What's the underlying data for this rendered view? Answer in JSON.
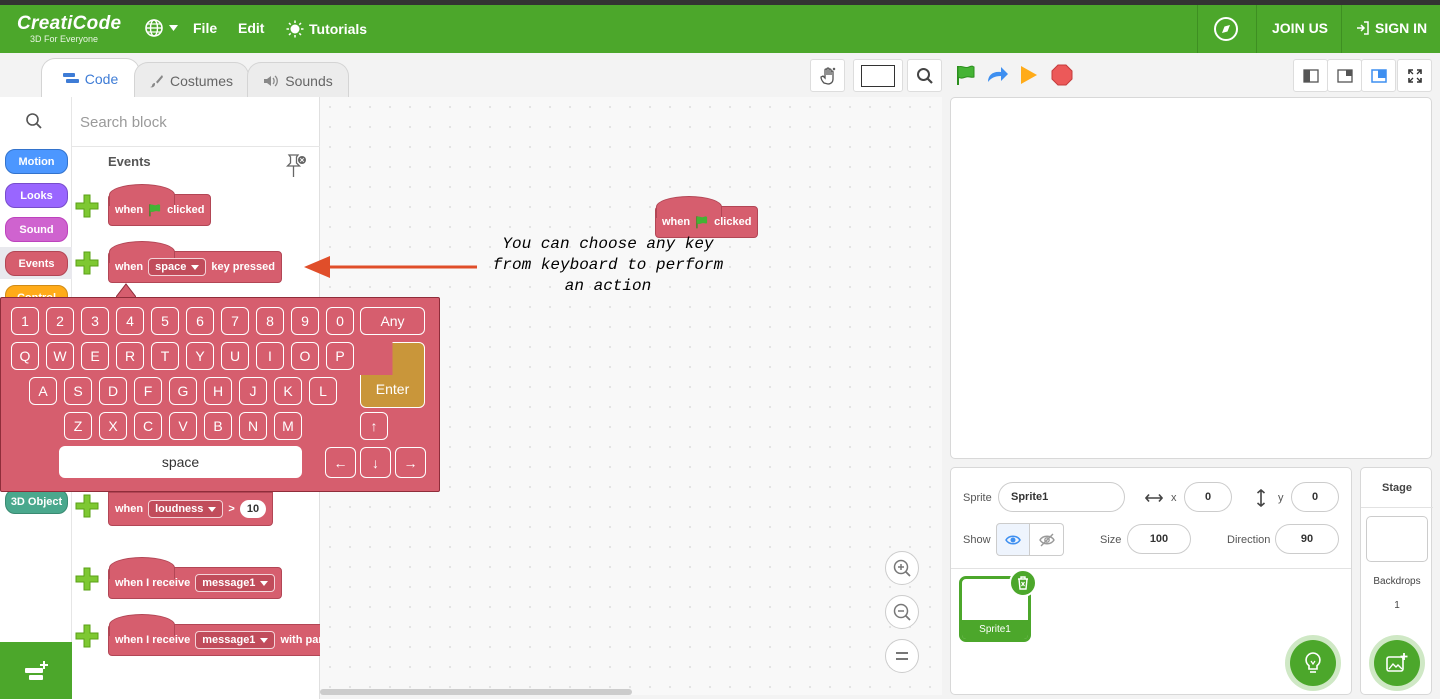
{
  "app": {
    "logo_title": "CreatiCode",
    "logo_subtitle": "3D For Everyone"
  },
  "menubar": {
    "file": "File",
    "edit": "Edit",
    "tutorials": "Tutorials",
    "join": "JOIN US",
    "signin": "SIGN IN"
  },
  "tabs": [
    {
      "label": "Code",
      "active": true
    },
    {
      "label": "Costumes"
    },
    {
      "label": "Sounds"
    }
  ],
  "search": {
    "placeholder": "Search block"
  },
  "categories": [
    {
      "label": "Motion",
      "color": "#4c97ff"
    },
    {
      "label": "Looks",
      "color": "#9966ff"
    },
    {
      "label": "Sound",
      "color": "#cf63cf"
    },
    {
      "label": "Events",
      "color": "#d65e6e"
    },
    {
      "label": "Control",
      "color": "#ffab19"
    },
    {
      "label": "3D Object",
      "color": "#4aa88d"
    }
  ],
  "palette": {
    "section_title": "Events",
    "blocks": {
      "flag_when": "when",
      "flag_clicked": "clicked",
      "key_when": "when",
      "key_value": "space",
      "key_pressed": "key pressed",
      "loud_when": "when",
      "loud_value": "loudness",
      "loud_op": ">",
      "loud_num": "10",
      "recv1_label": "when I receive",
      "recv1_value": "message1",
      "recv2_label": "when I receive",
      "recv2_value": "message1",
      "recv2_suffix": "with para"
    }
  },
  "workspace": {
    "block_when": "when",
    "block_clicked": "clicked",
    "annotation": "You can choose any key from keyboard to perform an action"
  },
  "keyboard": {
    "row1": [
      "1",
      "2",
      "3",
      "4",
      "5",
      "6",
      "7",
      "8",
      "9",
      "0"
    ],
    "any": "Any",
    "row2": [
      "Q",
      "W",
      "E",
      "R",
      "T",
      "Y",
      "U",
      "I",
      "O",
      "P"
    ],
    "row3": [
      "A",
      "S",
      "D",
      "F",
      "G",
      "H",
      "J",
      "K",
      "L"
    ],
    "row4": [
      "Z",
      "X",
      "C",
      "V",
      "B",
      "N",
      "M"
    ],
    "enter": "Enter",
    "space": "space",
    "arrows": {
      "up": "↑",
      "left": "←",
      "down": "↓",
      "right": "→"
    }
  },
  "sprite_info": {
    "sprite_label": "Sprite",
    "sprite_name": "Sprite1",
    "x_label": "x",
    "x": "0",
    "y_label": "y",
    "y": "0",
    "show_label": "Show",
    "size_label": "Size",
    "size": "100",
    "direction_label": "Direction",
    "direction": "90",
    "thumb_name": "Sprite1"
  },
  "stage_panel": {
    "title": "Stage",
    "backdrops_label": "Backdrops",
    "backdrops_count": "1"
  },
  "colors": {
    "brand": "#4ca72b",
    "events": "#d65e6e",
    "enter_key": "#c9963a"
  }
}
